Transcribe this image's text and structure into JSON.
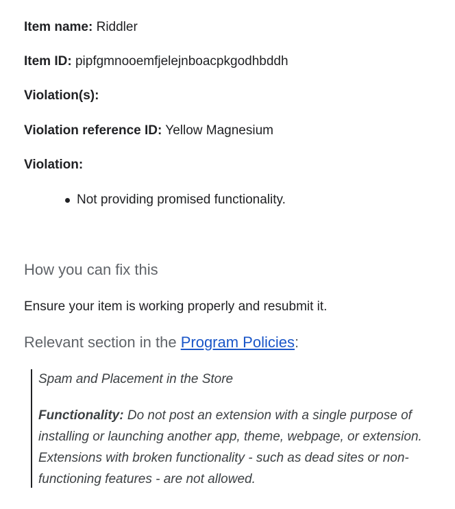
{
  "item_name": {
    "label": "Item name:",
    "value": "Riddler"
  },
  "item_id": {
    "label": "Item ID:",
    "value": "pipfgmnooemfjelejnboacpkgodhbddh"
  },
  "violations": {
    "label": "Violation(s):"
  },
  "violation_reference": {
    "label": "Violation reference ID:",
    "value": "Yellow Magnesium"
  },
  "violation": {
    "label": "Violation:",
    "items": [
      "Not providing promised functionality."
    ]
  },
  "fix_section": {
    "heading": "How you can fix this",
    "text": "Ensure your item is working properly and resubmit it."
  },
  "policy_section": {
    "heading_prefix": "Relevant section in the ",
    "link_text": "Program Policies",
    "heading_suffix": ":",
    "link_color": "#1a56c8"
  },
  "policy_quote": {
    "title": "Spam and Placement in the Store",
    "strong": "Functionality:",
    "body": " Do not post an extension with a single purpose of installing or launching another app, theme, webpage, or extension. Extensions with broken functionality - such as dead sites or non-functioning features - are not allowed."
  }
}
